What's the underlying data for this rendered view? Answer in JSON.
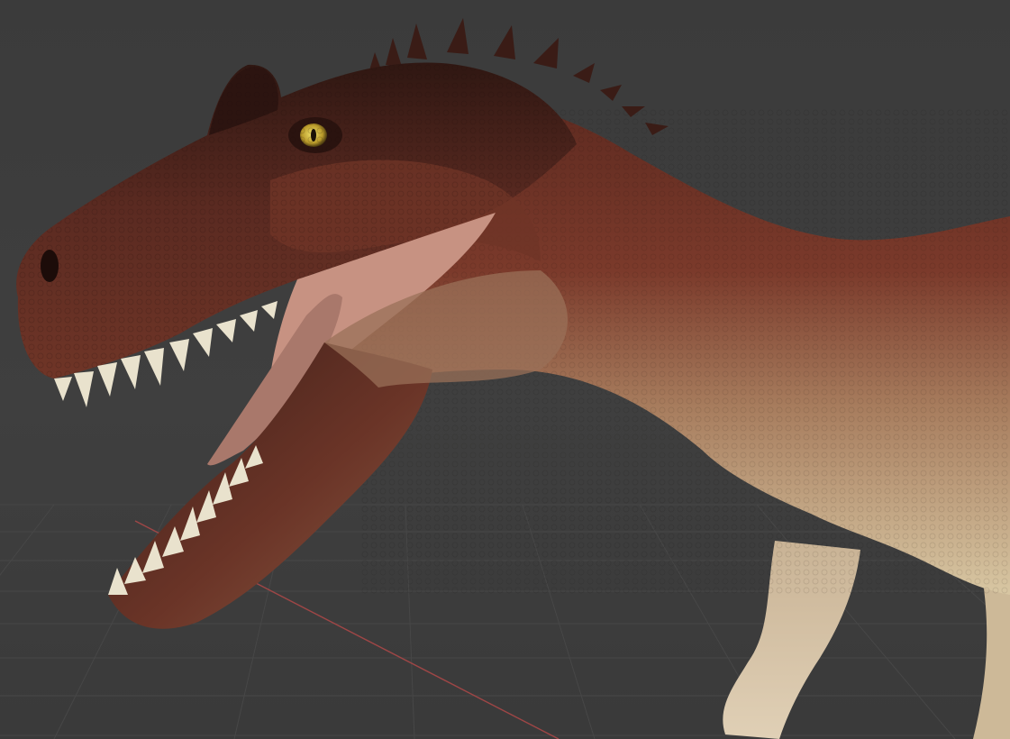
{
  "viewport": {
    "background": "#3d3d3d",
    "grid_color": "#474747",
    "x_axis_color": "#b04848",
    "subject": "dinosaur-model-icon"
  },
  "model": {
    "skin_dark": "#3a1c16",
    "skin_mid": "#6e3226",
    "skin_red": "#8a4130",
    "belly_light": "#d8c7a3",
    "mouth_inner": "#c79282",
    "teeth": "#e9e2cd",
    "eye": "#c7b13a"
  }
}
